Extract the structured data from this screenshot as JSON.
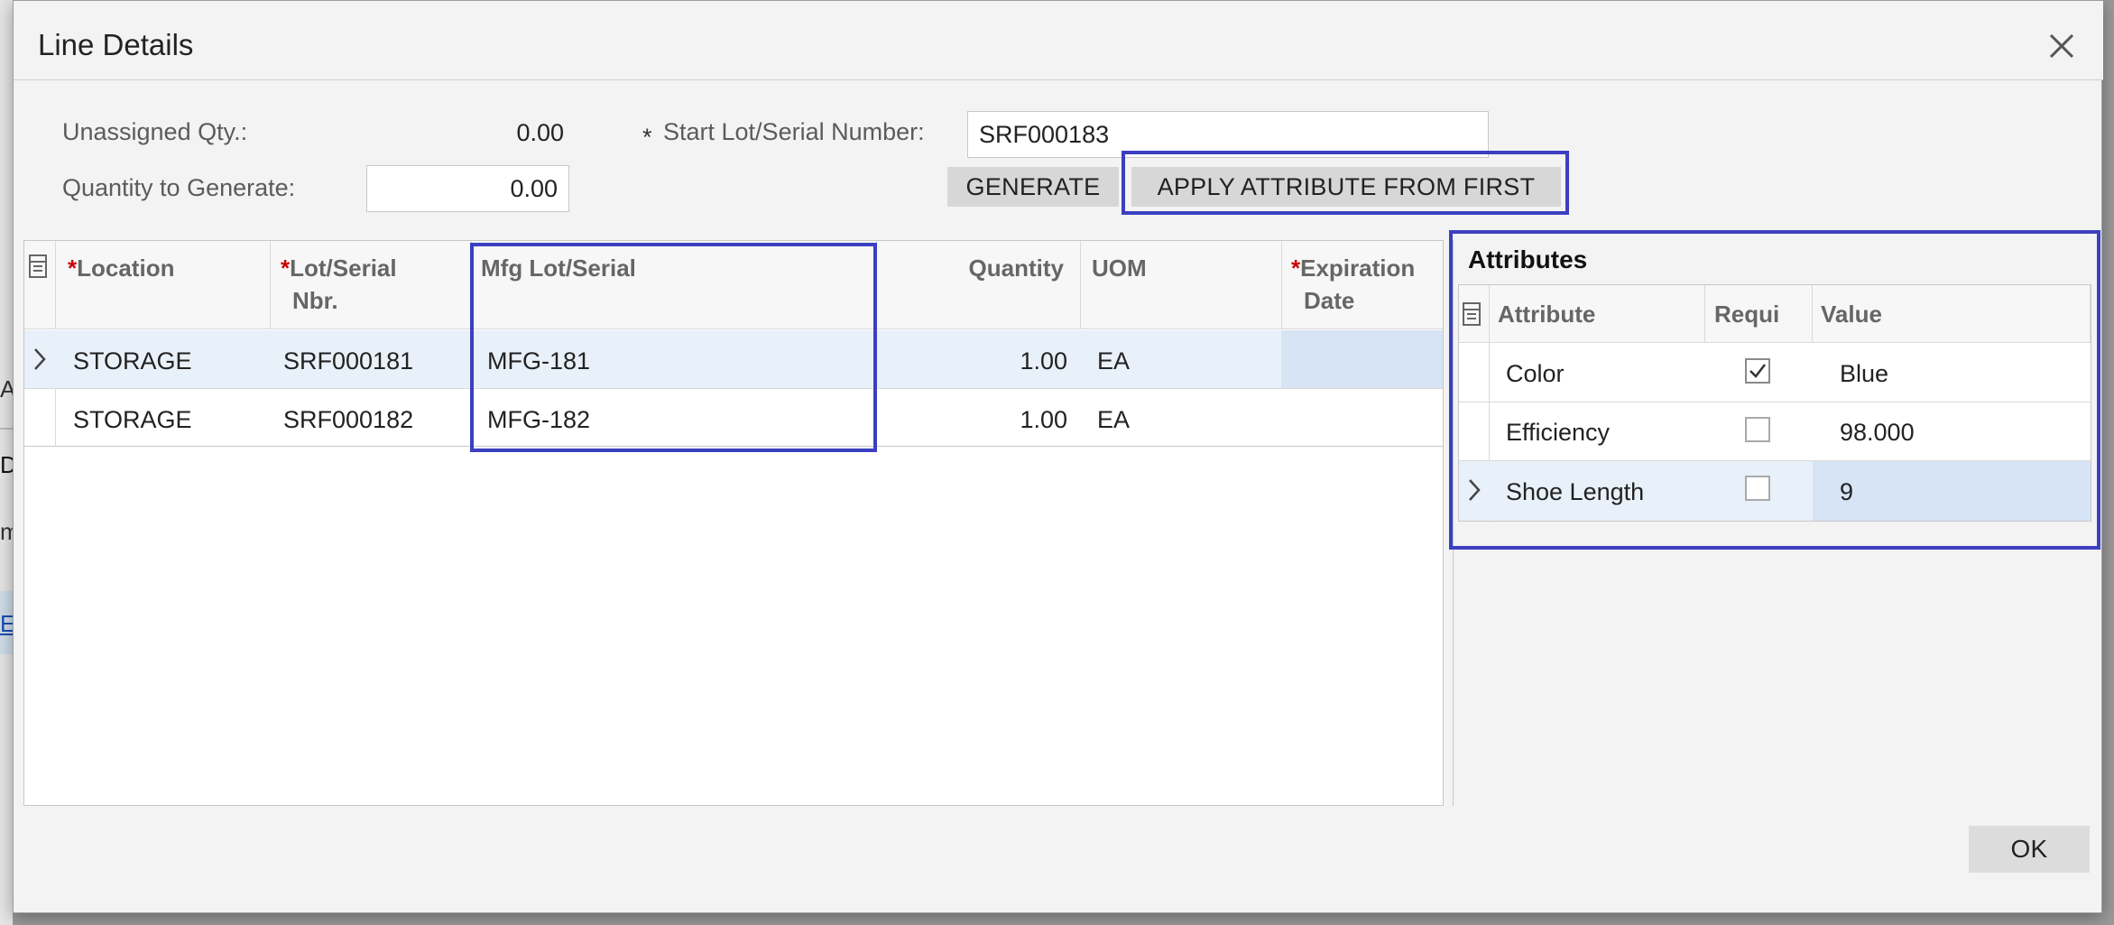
{
  "background": {
    "fragments": [
      "A",
      "D",
      "m",
      "ES"
    ]
  },
  "dialog": {
    "title": "Line Details",
    "close_icon": "close-icon"
  },
  "form": {
    "unassigned_label": "Unassigned Qty.:",
    "unassigned_value": "0.00",
    "qty_generate_label": "Quantity to Generate:",
    "qty_generate_value": "0.00",
    "start_lot_required": "*",
    "start_lot_label": "Start Lot/Serial Number:",
    "start_lot_value": "SRF000183",
    "generate_button": "GENERATE",
    "apply_button": "APPLY ATTRIBUTE FROM FIRST"
  },
  "lines_grid": {
    "columns": {
      "location": "Location",
      "lot_serial_line1": "Lot/Serial",
      "lot_serial_line2": "Nbr.",
      "mfg_lot": "Mfg Lot/Serial",
      "quantity": "Quantity",
      "uom": "UOM",
      "expiration_line1": "Expiration",
      "expiration_line2": "Date",
      "required_marker": "*"
    },
    "rows": [
      {
        "location": "STORAGE",
        "lot": "SRF000181",
        "mfg": "MFG-181",
        "qty": "1.00",
        "uom": "EA",
        "expiration": ""
      },
      {
        "location": "STORAGE",
        "lot": "SRF000182",
        "mfg": "MFG-182",
        "qty": "1.00",
        "uom": "EA",
        "expiration": ""
      }
    ]
  },
  "attributes": {
    "title": "Attributes",
    "columns": {
      "attribute": "Attribute",
      "required": "Requi",
      "value": "Value"
    },
    "rows": [
      {
        "attribute": "Color",
        "required": true,
        "value": "Blue"
      },
      {
        "attribute": "Efficiency",
        "required": false,
        "value": "98.000"
      },
      {
        "attribute": "Shoe Length",
        "required": false,
        "value": "9"
      }
    ]
  },
  "footer": {
    "ok_button": "OK"
  },
  "colors": {
    "highlight": "#3b3fc0",
    "selected_row": "#e8f0f9",
    "selected_cell": "#d6e4f5",
    "required": "#cc0000"
  }
}
